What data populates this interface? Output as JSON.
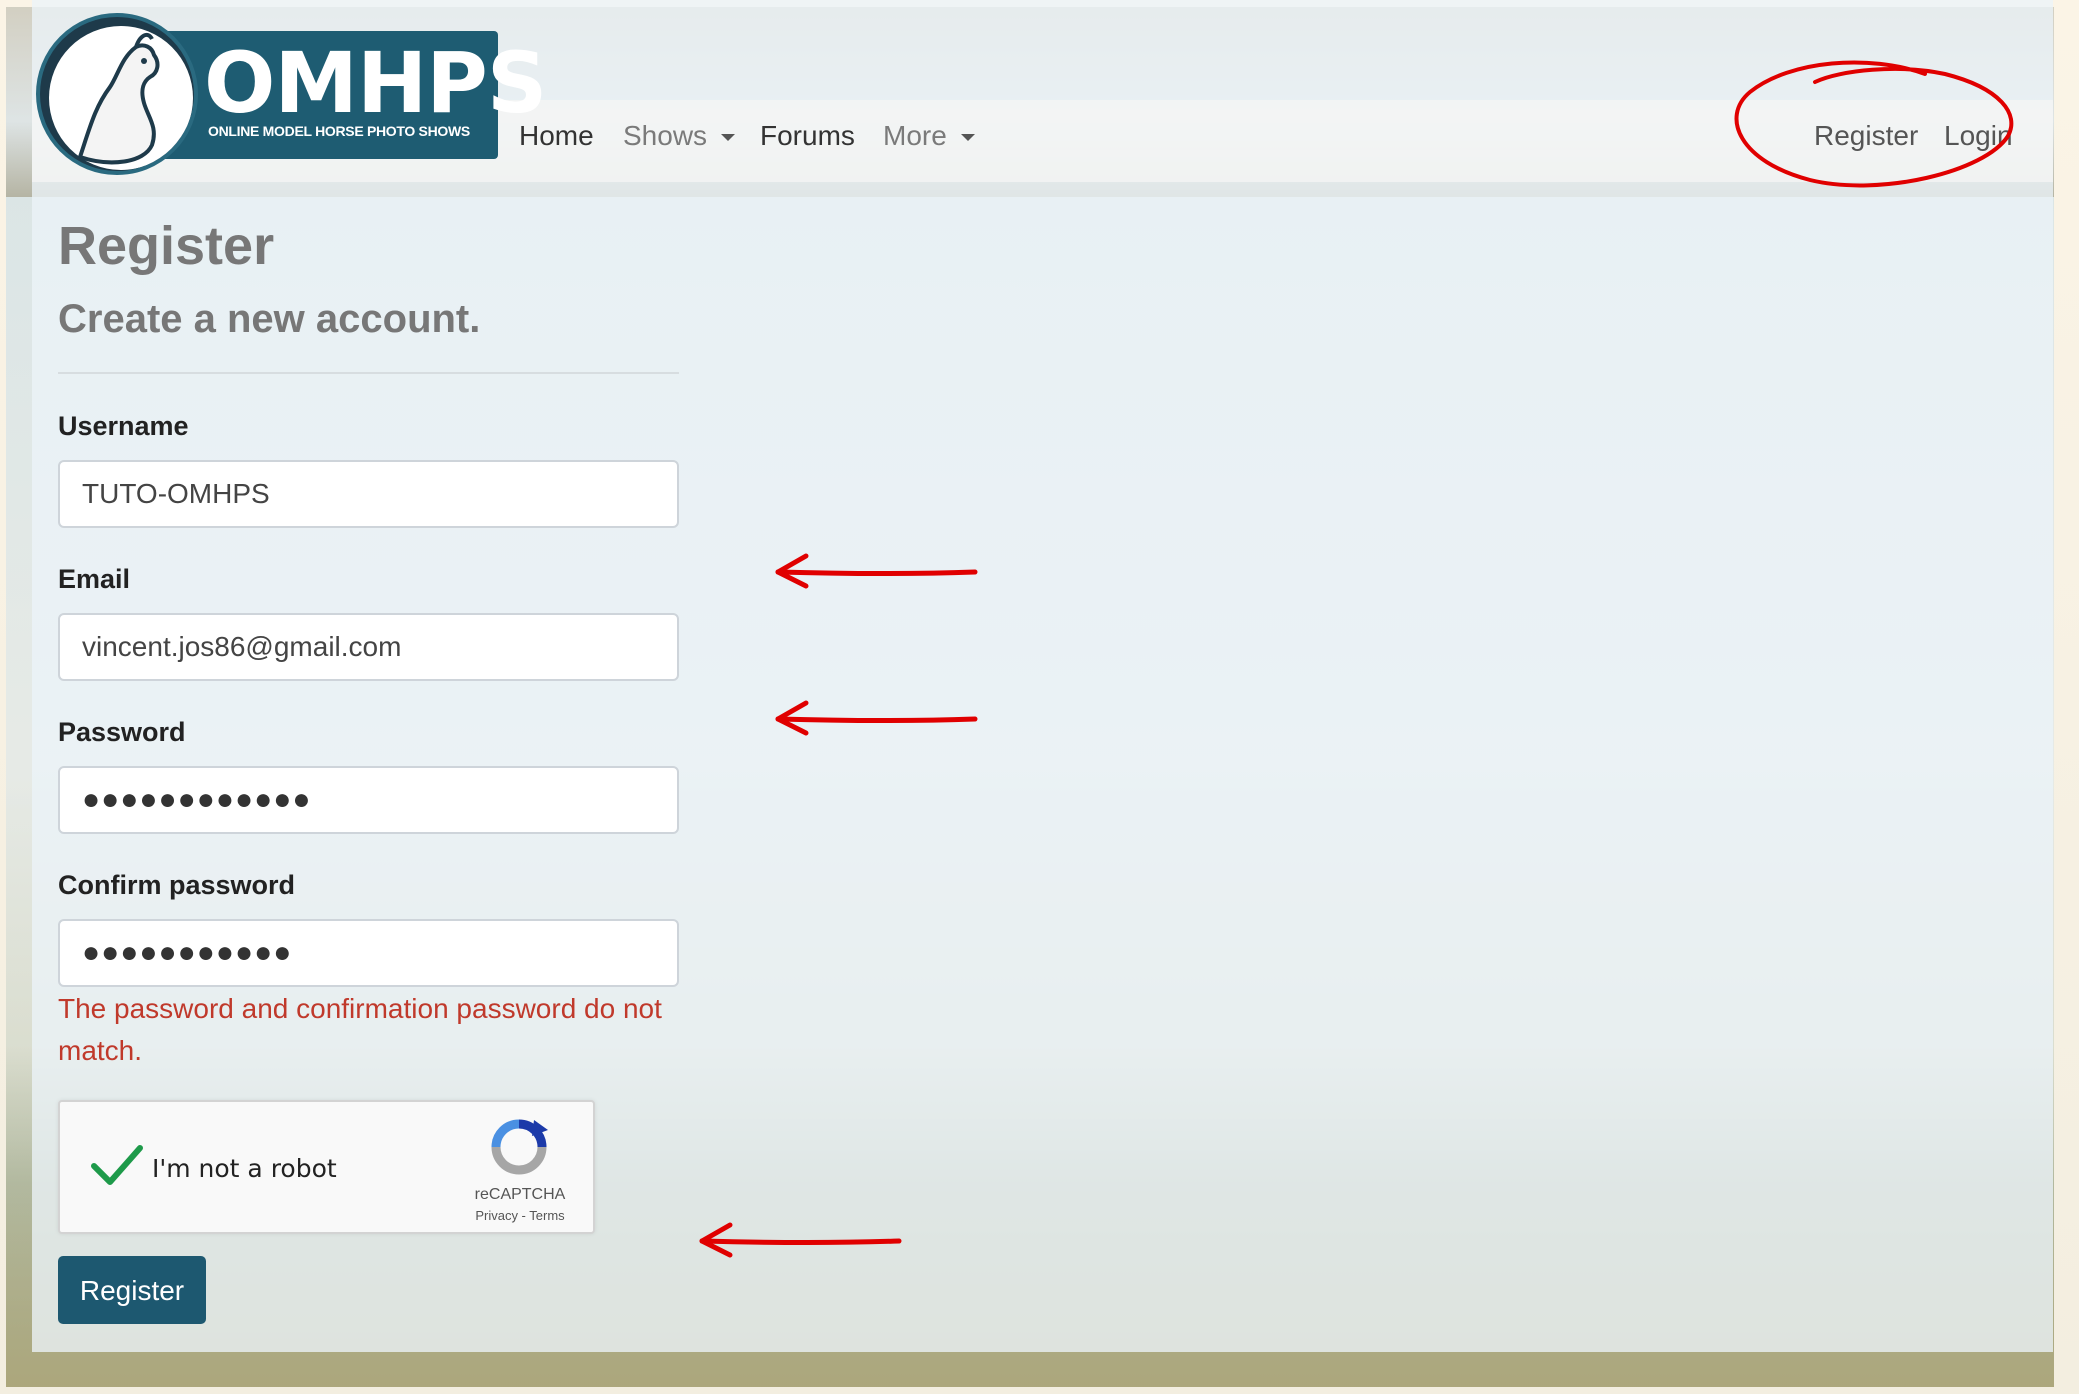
{
  "logo": {
    "title": "OMHPS",
    "subtitle": "ONLINE MODEL HORSE PHOTO SHOWS"
  },
  "nav": {
    "home": "Home",
    "shows": "Shows",
    "forums": "Forums",
    "more": "More",
    "register": "Register",
    "login": "Login"
  },
  "page": {
    "title": "Register",
    "subtitle": "Create a new account."
  },
  "form": {
    "username": {
      "label": "Username",
      "value": "TUTO-OMHPS"
    },
    "email": {
      "label": "Email",
      "value": "vincent.jos86@gmail.com"
    },
    "password": {
      "label": "Password",
      "value": "●●●●●●●●●●●●"
    },
    "confirm_password": {
      "label": "Confirm password",
      "value": "●●●●●●●●●●●"
    },
    "error": "The password and confirmation password do not match.",
    "submit_label": "Register"
  },
  "captcha": {
    "label": "I'm not a robot",
    "brand": "reCAPTCHA",
    "links": "Privacy - Terms",
    "checked": true
  },
  "colors": {
    "brand": "#1e5c72",
    "error": "#c0392b",
    "annotation": "#e00000"
  }
}
